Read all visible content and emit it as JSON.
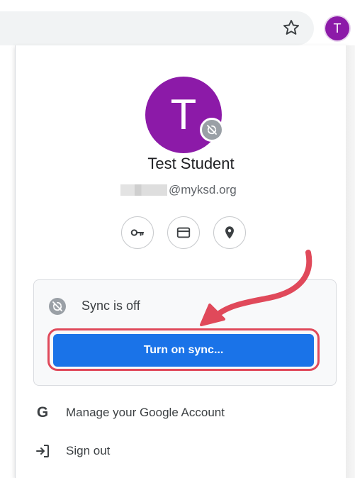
{
  "toolbar": {
    "avatar_initial": "T",
    "star_icon": "bookmark-star-icon"
  },
  "profile": {
    "avatar_initial": "T",
    "name": "Test Student",
    "email_domain": "@myksd.org",
    "badge_icon": "sync-off-icon"
  },
  "quick_actions": [
    {
      "icon": "key-icon"
    },
    {
      "icon": "card-icon"
    },
    {
      "icon": "location-pin-icon"
    }
  ],
  "sync": {
    "status": "Sync is off",
    "button_label": "Turn on sync..."
  },
  "menu": {
    "items": [
      {
        "label": "Manage your Google Account",
        "icon": "google-g-icon"
      },
      {
        "label": "Sign out",
        "icon": "sign-out-icon"
      }
    ]
  },
  "colors": {
    "avatar": "#8c1aa8",
    "primary_button": "#1a73e8",
    "annotation": "#e0495a"
  }
}
